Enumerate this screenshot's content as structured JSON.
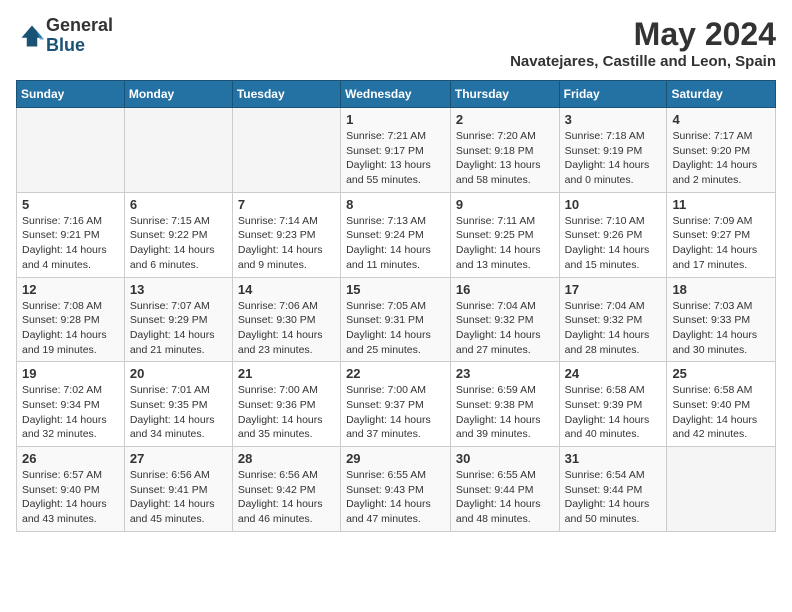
{
  "header": {
    "logo_general": "General",
    "logo_blue": "Blue",
    "month_title": "May 2024",
    "location": "Navatejares, Castille and Leon, Spain"
  },
  "weekdays": [
    "Sunday",
    "Monday",
    "Tuesday",
    "Wednesday",
    "Thursday",
    "Friday",
    "Saturday"
  ],
  "weeks": [
    [
      {
        "day": "",
        "info": ""
      },
      {
        "day": "",
        "info": ""
      },
      {
        "day": "",
        "info": ""
      },
      {
        "day": "1",
        "info": "Sunrise: 7:21 AM\nSunset: 9:17 PM\nDaylight: 13 hours\nand 55 minutes."
      },
      {
        "day": "2",
        "info": "Sunrise: 7:20 AM\nSunset: 9:18 PM\nDaylight: 13 hours\nand 58 minutes."
      },
      {
        "day": "3",
        "info": "Sunrise: 7:18 AM\nSunset: 9:19 PM\nDaylight: 14 hours\nand 0 minutes."
      },
      {
        "day": "4",
        "info": "Sunrise: 7:17 AM\nSunset: 9:20 PM\nDaylight: 14 hours\nand 2 minutes."
      }
    ],
    [
      {
        "day": "5",
        "info": "Sunrise: 7:16 AM\nSunset: 9:21 PM\nDaylight: 14 hours\nand 4 minutes."
      },
      {
        "day": "6",
        "info": "Sunrise: 7:15 AM\nSunset: 9:22 PM\nDaylight: 14 hours\nand 6 minutes."
      },
      {
        "day": "7",
        "info": "Sunrise: 7:14 AM\nSunset: 9:23 PM\nDaylight: 14 hours\nand 9 minutes."
      },
      {
        "day": "8",
        "info": "Sunrise: 7:13 AM\nSunset: 9:24 PM\nDaylight: 14 hours\nand 11 minutes."
      },
      {
        "day": "9",
        "info": "Sunrise: 7:11 AM\nSunset: 9:25 PM\nDaylight: 14 hours\nand 13 minutes."
      },
      {
        "day": "10",
        "info": "Sunrise: 7:10 AM\nSunset: 9:26 PM\nDaylight: 14 hours\nand 15 minutes."
      },
      {
        "day": "11",
        "info": "Sunrise: 7:09 AM\nSunset: 9:27 PM\nDaylight: 14 hours\nand 17 minutes."
      }
    ],
    [
      {
        "day": "12",
        "info": "Sunrise: 7:08 AM\nSunset: 9:28 PM\nDaylight: 14 hours\nand 19 minutes."
      },
      {
        "day": "13",
        "info": "Sunrise: 7:07 AM\nSunset: 9:29 PM\nDaylight: 14 hours\nand 21 minutes."
      },
      {
        "day": "14",
        "info": "Sunrise: 7:06 AM\nSunset: 9:30 PM\nDaylight: 14 hours\nand 23 minutes."
      },
      {
        "day": "15",
        "info": "Sunrise: 7:05 AM\nSunset: 9:31 PM\nDaylight: 14 hours\nand 25 minutes."
      },
      {
        "day": "16",
        "info": "Sunrise: 7:04 AM\nSunset: 9:32 PM\nDaylight: 14 hours\nand 27 minutes."
      },
      {
        "day": "17",
        "info": "Sunrise: 7:04 AM\nSunset: 9:32 PM\nDaylight: 14 hours\nand 28 minutes."
      },
      {
        "day": "18",
        "info": "Sunrise: 7:03 AM\nSunset: 9:33 PM\nDaylight: 14 hours\nand 30 minutes."
      }
    ],
    [
      {
        "day": "19",
        "info": "Sunrise: 7:02 AM\nSunset: 9:34 PM\nDaylight: 14 hours\nand 32 minutes."
      },
      {
        "day": "20",
        "info": "Sunrise: 7:01 AM\nSunset: 9:35 PM\nDaylight: 14 hours\nand 34 minutes."
      },
      {
        "day": "21",
        "info": "Sunrise: 7:00 AM\nSunset: 9:36 PM\nDaylight: 14 hours\nand 35 minutes."
      },
      {
        "day": "22",
        "info": "Sunrise: 7:00 AM\nSunset: 9:37 PM\nDaylight: 14 hours\nand 37 minutes."
      },
      {
        "day": "23",
        "info": "Sunrise: 6:59 AM\nSunset: 9:38 PM\nDaylight: 14 hours\nand 39 minutes."
      },
      {
        "day": "24",
        "info": "Sunrise: 6:58 AM\nSunset: 9:39 PM\nDaylight: 14 hours\nand 40 minutes."
      },
      {
        "day": "25",
        "info": "Sunrise: 6:58 AM\nSunset: 9:40 PM\nDaylight: 14 hours\nand 42 minutes."
      }
    ],
    [
      {
        "day": "26",
        "info": "Sunrise: 6:57 AM\nSunset: 9:40 PM\nDaylight: 14 hours\nand 43 minutes."
      },
      {
        "day": "27",
        "info": "Sunrise: 6:56 AM\nSunset: 9:41 PM\nDaylight: 14 hours\nand 45 minutes."
      },
      {
        "day": "28",
        "info": "Sunrise: 6:56 AM\nSunset: 9:42 PM\nDaylight: 14 hours\nand 46 minutes."
      },
      {
        "day": "29",
        "info": "Sunrise: 6:55 AM\nSunset: 9:43 PM\nDaylight: 14 hours\nand 47 minutes."
      },
      {
        "day": "30",
        "info": "Sunrise: 6:55 AM\nSunset: 9:44 PM\nDaylight: 14 hours\nand 48 minutes."
      },
      {
        "day": "31",
        "info": "Sunrise: 6:54 AM\nSunset: 9:44 PM\nDaylight: 14 hours\nand 50 minutes."
      },
      {
        "day": "",
        "info": ""
      }
    ]
  ]
}
